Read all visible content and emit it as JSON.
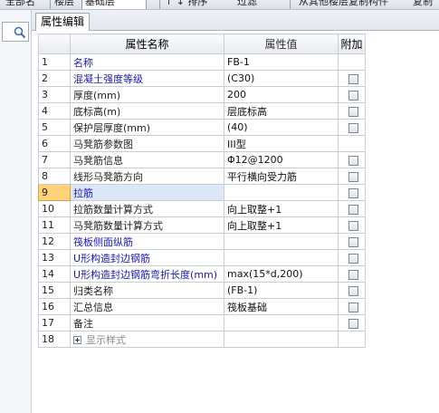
{
  "toolbar": {
    "items": [
      "全部名",
      "楼层",
      "基础层",
      "↑ ↓ 排序",
      "过滤",
      "从其他楼层复制构件",
      "复制"
    ]
  },
  "search": {
    "placeholder": ""
  },
  "panel": {
    "tab_label": "属性编辑"
  },
  "grid": {
    "columns": {
      "name": "属性名称",
      "value": "属性值",
      "extra": "附加"
    },
    "rows": [
      {
        "n": "1",
        "name": "名称",
        "value": "FB-1",
        "blue": true,
        "checkbox": false
      },
      {
        "n": "2",
        "name": "混凝土强度等级",
        "value": "(C30)",
        "blue": true,
        "checkbox": true
      },
      {
        "n": "3",
        "name": "厚度(mm)",
        "value": "200",
        "blue": false,
        "checkbox": true
      },
      {
        "n": "4",
        "name": "底标高(m)",
        "value": "层底标高",
        "blue": false,
        "checkbox": true
      },
      {
        "n": "5",
        "name": "保护层厚度(mm)",
        "value": "(40)",
        "blue": false,
        "checkbox": true
      },
      {
        "n": "6",
        "name": "马凳筋参数图",
        "value": "III型",
        "blue": false,
        "checkbox": false
      },
      {
        "n": "7",
        "name": "马凳筋信息",
        "value": "Φ12@1200",
        "blue": false,
        "checkbox": true
      },
      {
        "n": "8",
        "name": "线形马凳筋方向",
        "value": "平行横向受力筋",
        "blue": false,
        "checkbox": true
      },
      {
        "n": "9",
        "name": "拉筋",
        "value": "",
        "blue": true,
        "checkbox": true,
        "selected": true
      },
      {
        "n": "10",
        "name": "拉筋数量计算方式",
        "value": "向上取整+1",
        "blue": false,
        "checkbox": true
      },
      {
        "n": "11",
        "name": "马凳筋数量计算方式",
        "value": "向上取整+1",
        "blue": false,
        "checkbox": true
      },
      {
        "n": "12",
        "name": "筏板侧面纵筋",
        "value": "",
        "blue": true,
        "checkbox": true
      },
      {
        "n": "13",
        "name": "U形构造封边钢筋",
        "value": "",
        "blue": true,
        "checkbox": true
      },
      {
        "n": "14",
        "name": "U形构造封边钢筋弯折长度(mm)",
        "value": "max(15*d,200)",
        "blue": true,
        "checkbox": true
      },
      {
        "n": "15",
        "name": "归类名称",
        "value": "(FB-1)",
        "blue": false,
        "checkbox": true
      },
      {
        "n": "16",
        "name": "汇总信息",
        "value": "筏板基础",
        "blue": false,
        "checkbox": true
      },
      {
        "n": "17",
        "name": "备注",
        "value": "",
        "blue": false,
        "checkbox": true
      },
      {
        "n": "18",
        "name": "显示样式",
        "value": "",
        "blue": false,
        "checkbox": false,
        "expandable": true,
        "grey": true
      }
    ]
  },
  "colors": {
    "header_highlight": "#f8c96a",
    "selected_row": "#dce7f8",
    "blue_text": "#1a1ab0"
  }
}
